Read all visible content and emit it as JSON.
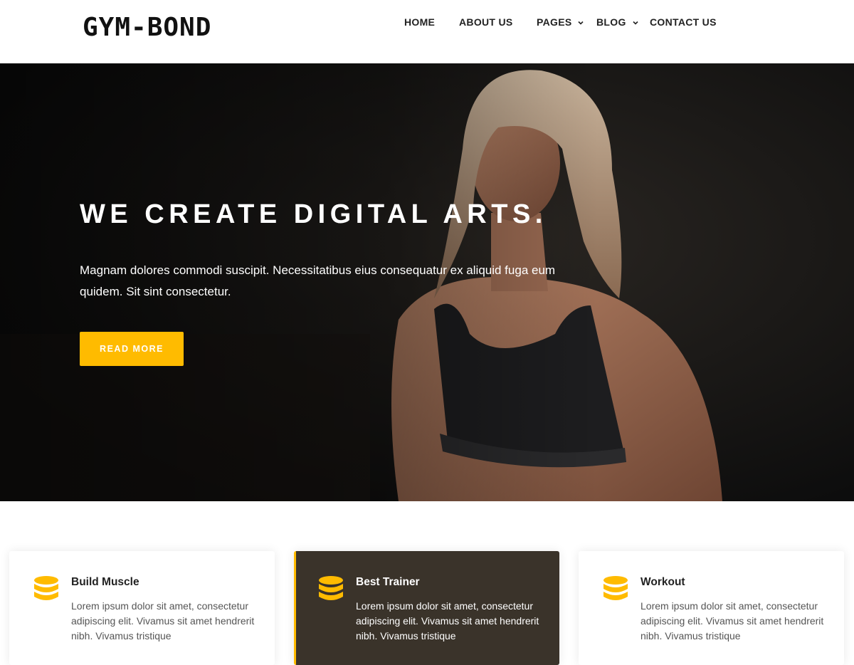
{
  "brand": {
    "logo_text": "GYM-BOND"
  },
  "nav": {
    "items": [
      {
        "label": "HOME",
        "has_dropdown": false
      },
      {
        "label": "ABOUT US",
        "has_dropdown": false
      },
      {
        "label": "PAGES",
        "has_dropdown": true
      },
      {
        "label": "BLOG",
        "has_dropdown": true
      },
      {
        "label": "CONTACT US",
        "has_dropdown": false
      }
    ]
  },
  "hero": {
    "title": "WE CREATE DIGITAL ARTS.",
    "text": "Magnam dolores commodi suscipit. Necessitatibus eius consequatur ex aliquid fuga eum quidem. Sit sint consectetur.",
    "button_label": "READ MORE"
  },
  "features": [
    {
      "title": "Build Muscle",
      "text": "Lorem ipsum dolor sit amet, consectetur adipiscing elit. Vivamus sit amet hendrerit nibh. Vivamus tristique",
      "icon": "database-icon",
      "active": false
    },
    {
      "title": "Best Trainer",
      "text": "Lorem ipsum dolor sit amet, consectetur adipiscing elit. Vivamus sit amet hendrerit nibh. Vivamus tristique",
      "icon": "database-icon",
      "active": true
    },
    {
      "title": "Workout",
      "text": "Lorem ipsum dolor sit amet, consectetur adipiscing elit. Vivamus sit amet hendrerit nibh. Vivamus tristique",
      "icon": "database-icon",
      "active": false
    }
  ],
  "colors": {
    "accent": "#ffbb00",
    "active_card": "#3a332a",
    "hero_bg": "#141414"
  }
}
